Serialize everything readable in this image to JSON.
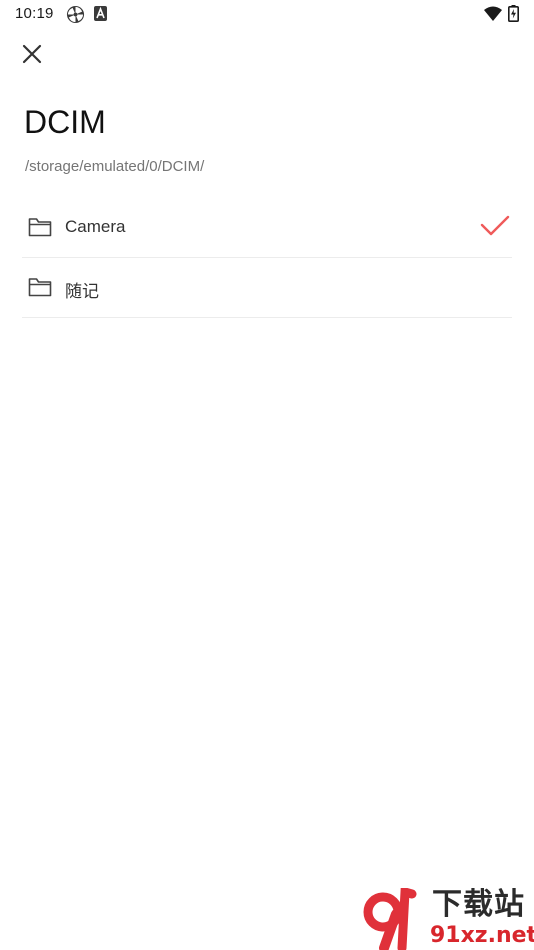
{
  "status_bar": {
    "time": "10:19",
    "left_icons": [
      "pinwheel-icon",
      "a-badge-icon"
    ],
    "right_icons": [
      "wifi-icon",
      "battery-charging-icon"
    ]
  },
  "header": {
    "close_icon": "close-icon",
    "title": "DCIM",
    "path": "/storage/emulated/0/DCIM/"
  },
  "folders": [
    {
      "label": "Camera",
      "icon": "folder-icon",
      "selected": true
    },
    {
      "label": "随记",
      "icon": "folder-icon",
      "selected": false
    }
  ],
  "colors": {
    "accent": "#ef5a5a",
    "text_primary": "#111111",
    "text_secondary": "#757575",
    "divider": "#ececec"
  },
  "watermark": {
    "number": "91",
    "chinese": "下载站",
    "domain": "91xz.net"
  }
}
